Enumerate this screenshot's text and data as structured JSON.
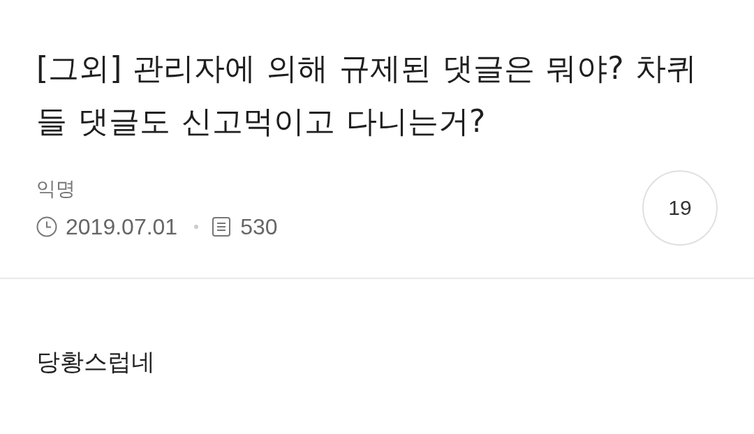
{
  "post": {
    "title": "[그외] 관리자에 의해 규제된 댓글은 뭐야? 차퀴들 댓글도 신고먹이고 다니는거?",
    "author": "익명",
    "date": "2019.07.01",
    "views": "530",
    "comment_count": "19",
    "body": "당황스럽네"
  }
}
